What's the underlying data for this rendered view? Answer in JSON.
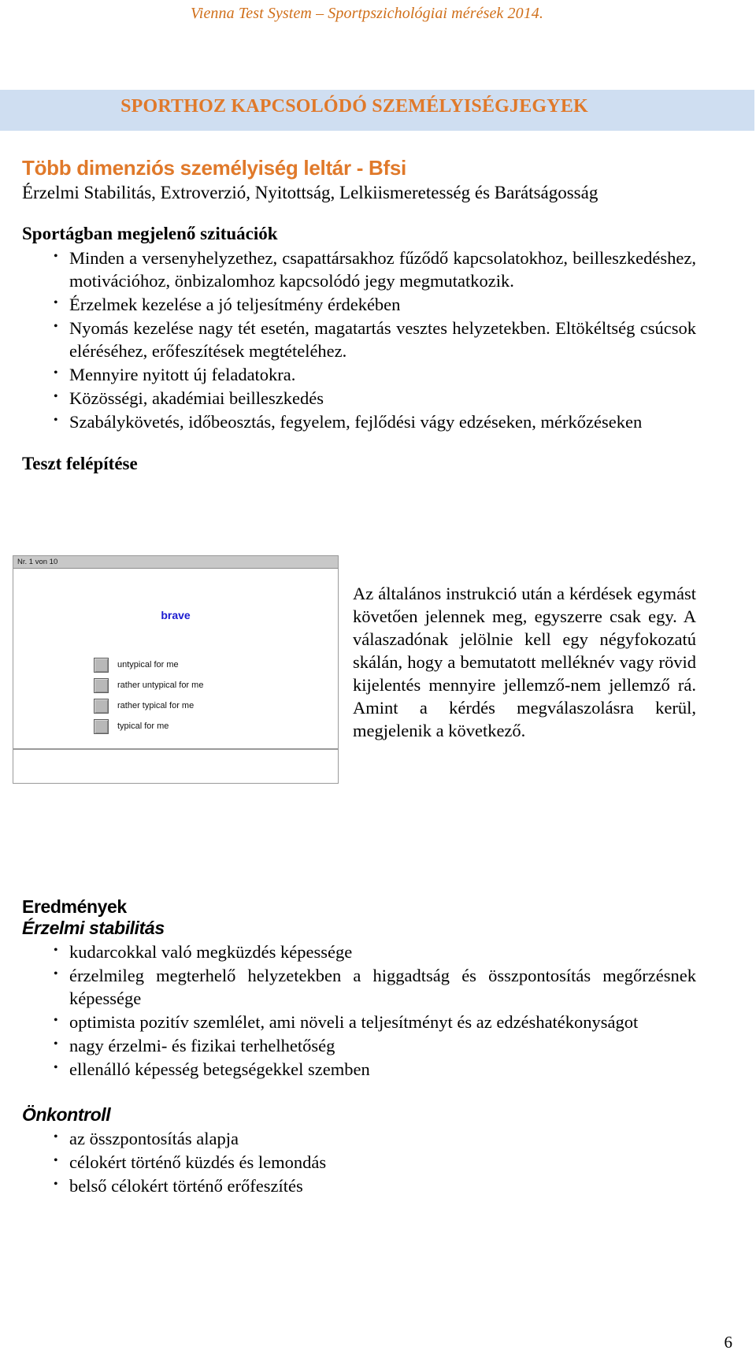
{
  "document": {
    "running_header": "Vienna Test System – Sportpszichológiai mérések 2014.",
    "banner_title": "SPORTHOZ KAPCSOLÓDÓ SZEMÉLYISÉGJEGYEK",
    "page_number": "6",
    "colors": {
      "accent_orange": "#e0792a",
      "header_orange": "#d06f1a",
      "banner_blue": "#cfdef1",
      "shot_stem_blue": "#1a1ad0"
    }
  },
  "test": {
    "title": "Több dimenziós személyiség leltár - Bfsi",
    "subtitle": "Érzelmi Stabilitás, Extroverzió, Nyitottság, Lelkiismeretesség és Barátságosság"
  },
  "situations": {
    "heading": "Sportágban megjelenő szituációk",
    "items": [
      "Minden a versenyhelyzethez, csapattársakhoz fűződő kapcsolatokhoz, beilleszkedéshez, motivációhoz, önbizalomhoz kapcsolódó jegy megmutatkozik.",
      "Érzelmek kezelése a jó teljesítmény érdekében",
      "Nyomás kezelése nagy tét esetén, magatartás vesztes helyzetekben. Eltökéltség csúcsok eléréséhez, erőfeszítések megtételéhez.",
      "Mennyire nyitott új feladatokra.",
      "Közösségi, akadémiai beilleszkedés",
      "Szabálykövetés, időbeosztás, fegyelem, fejlődési vágy edzéseken, mérkőzéseken"
    ]
  },
  "structure": {
    "heading": "Teszt felépítése",
    "screenshot": {
      "titlebar": "Nr. 1 von 10",
      "stem": "brave",
      "options": [
        "untypical for me",
        "rather untypical for me",
        "rather typical for me",
        "typical for me"
      ]
    },
    "explanation": "Az általános instrukció után a kérdések egymást követően jelennek meg, egyszerre csak egy. A válaszadónak jelölnie kell egy négyfokozatú skálán, hogy a bemutatott melléknév vagy rövid kijelentés mennyire jellemző-nem jellemző rá. Amint a kérdés megválaszolásra kerül, megjelenik a következő."
  },
  "results": {
    "heading": "Eredmények",
    "groups": [
      {
        "name": "Érzelmi stabilitás",
        "items": [
          "kudarcokkal való megküzdés képessége",
          "érzelmileg megterhelő helyzetekben a higgadtság és összpontosítás megőrzésnek képessége",
          "optimista pozitív szemlélet, ami növeli a teljesítményt és az edzéshatékonyságot",
          "nagy érzelmi- és fizikai terhelhetőség",
          "ellenálló képesség betegségekkel szemben"
        ]
      },
      {
        "name": "Önkontroll",
        "items": [
          "az összpontosítás alapja",
          "célokért történő küzdés és lemondás",
          "belső célokért történő erőfeszítés"
        ]
      }
    ]
  }
}
